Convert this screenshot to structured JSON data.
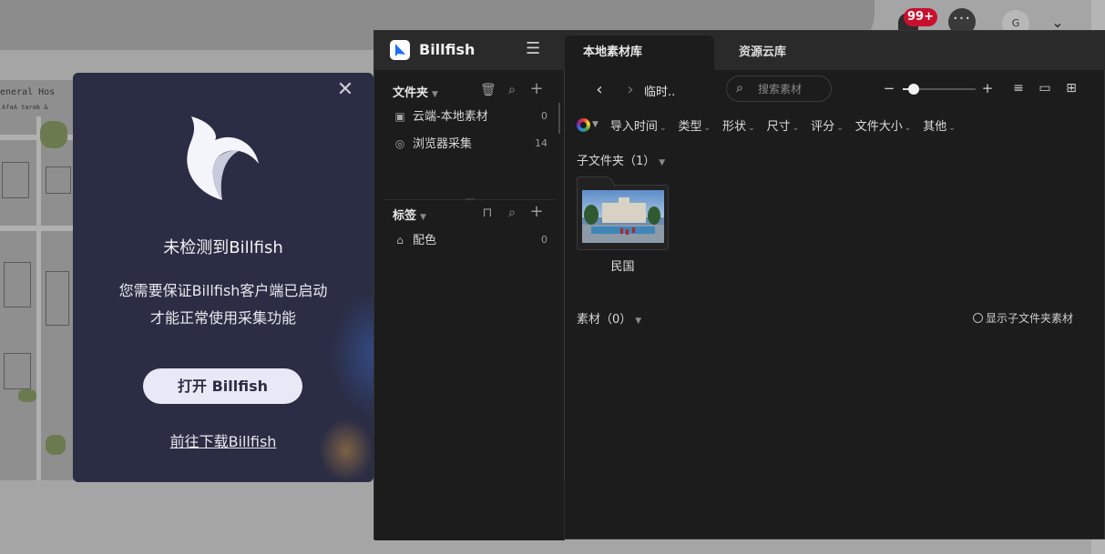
{
  "background": {
    "notification_badge": "99+",
    "avatar_letter": "G",
    "map_text_1": "eneral Hos",
    "map_text_2": "AfaA  tarak &"
  },
  "popup": {
    "title": "未检测到Billfish",
    "desc_line1": "您需要保证Billfish客户端已启动",
    "desc_line2": "才能正常使用采集功能",
    "open_button": "打开 Billfish",
    "download_link": "前往下载Billfish"
  },
  "app": {
    "name": "Billfish",
    "tabs": [
      {
        "label": "本地素材库",
        "active": true
      },
      {
        "label": "资源云库",
        "active": false
      }
    ]
  },
  "sidebar": {
    "folders_header": "文件夹",
    "folders": [
      {
        "label": "云端-本地素材",
        "count": "0",
        "icon": "storage-icon"
      },
      {
        "label": "浏览器采集",
        "count": "14",
        "icon": "compass-icon"
      }
    ],
    "tags_header": "标签",
    "tags": [
      {
        "label": "配色",
        "count": "0",
        "icon": "tag-icon"
      }
    ]
  },
  "toolbar": {
    "breadcrumb": "临时..",
    "search_placeholder": "搜索素材",
    "zoom_level": 0.15
  },
  "filters": [
    "导入时间",
    "类型",
    "形状",
    "尺寸",
    "评分",
    "文件大小",
    "其他"
  ],
  "subfolders": {
    "header": "子文件夹",
    "count": "（1）",
    "items": [
      {
        "name": "民国"
      }
    ]
  },
  "materials": {
    "header": "素材",
    "count": "（0）",
    "show_sub_label": "显示子文件夹素材"
  },
  "colors": {
    "popup_bg": "#2b2d44",
    "app_bg": "#1c1c1c",
    "badge_red": "#c8102e",
    "brand_blue": "#1e6cf5"
  }
}
